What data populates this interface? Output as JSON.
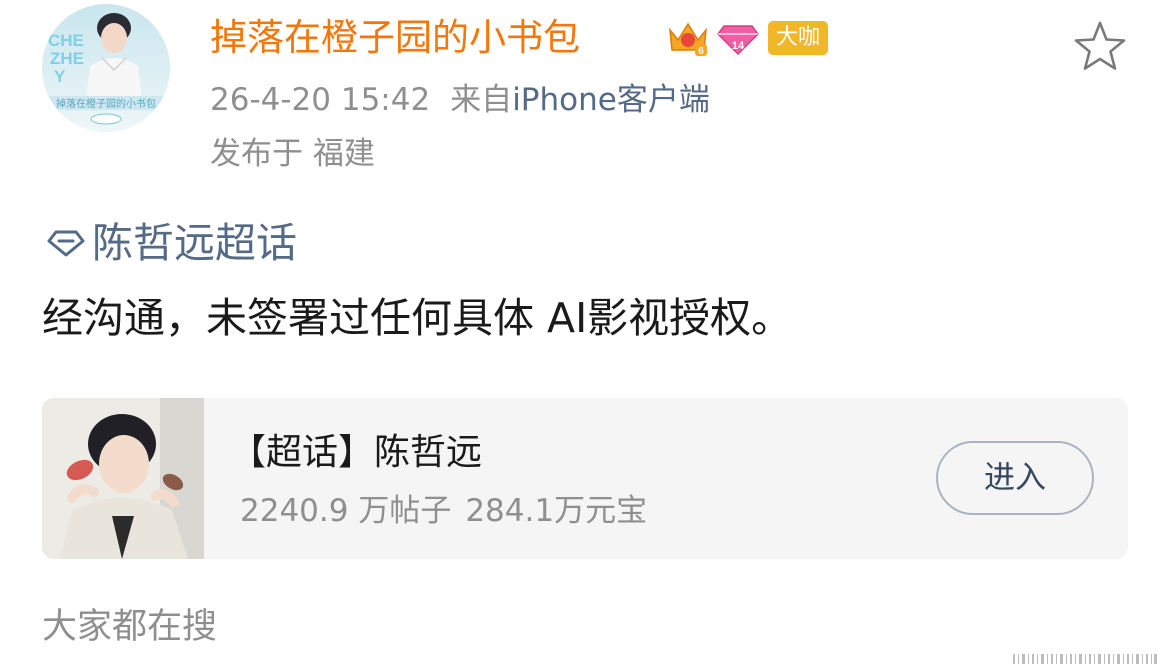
{
  "author": {
    "name": "掉落在橙子园的小书包",
    "avatar_icon": "avatar-image",
    "avatar_text_lines": [
      "CHE",
      "ZHE",
      "Y"
    ],
    "avatar_caption": "掉落在橙子园的小书包",
    "badges": [
      {
        "icon": "crown-level-badge-icon",
        "text": "6"
      },
      {
        "icon": "diamond-badge-icon",
        "text": "14"
      }
    ],
    "tag_label": "大咖",
    "name_color": "#f5760a",
    "tag_color": "#f2b728"
  },
  "post": {
    "date": "26-4-20 15:42",
    "source_prefix": "来自",
    "source": "iPhone客户端",
    "location": "发布于 福建",
    "topic": "陈哲远超话",
    "body": "经沟通，未签署过任何具体 AI影视授权。"
  },
  "favorite": {
    "icon": "star-icon"
  },
  "topic_card": {
    "thumbnail_icon": "portrait-thumbnail",
    "title": "【超话】陈哲远",
    "posts": "2240.9 万帖子",
    "coins": "284.1万元宝",
    "enter_label": "进入"
  },
  "section": {
    "search_heading": "大家都在搜"
  },
  "colors": {
    "link_blue": "#556a86",
    "secondary_gray": "#8f8f8f",
    "card_background": "#f5f5f5"
  }
}
